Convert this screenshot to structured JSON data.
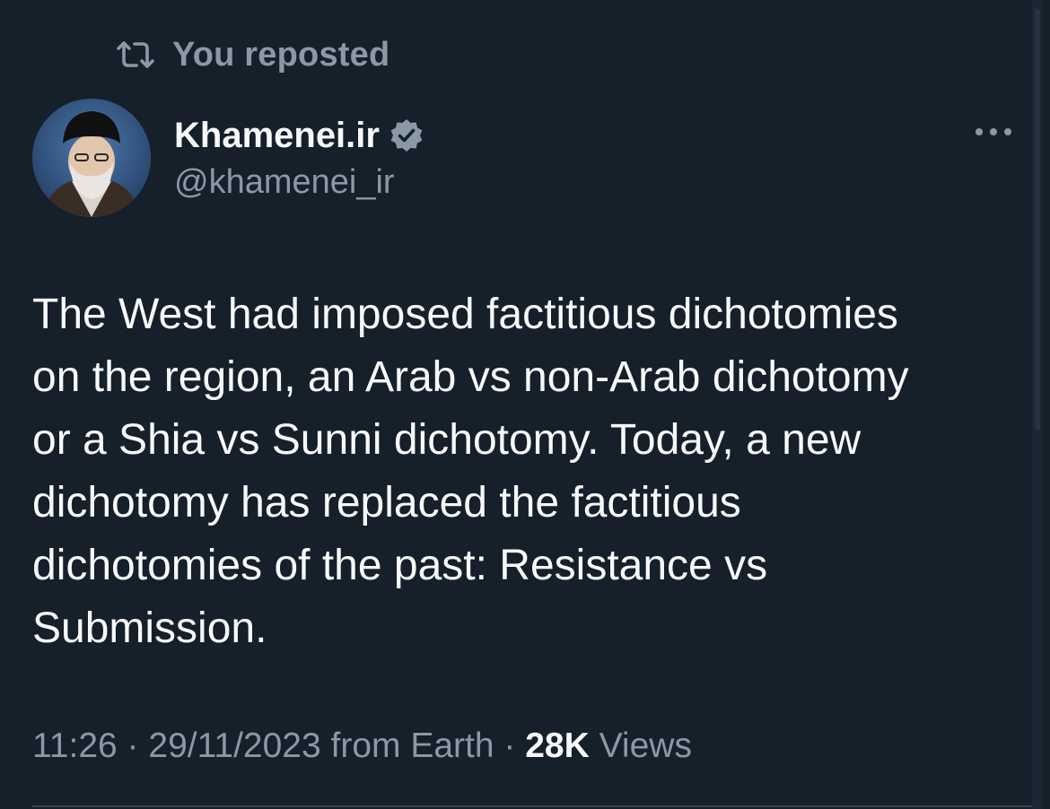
{
  "repost": {
    "label": "You reposted",
    "icon": "repost-icon"
  },
  "author": {
    "display_name": "Khamenei.ir",
    "handle": "@khamenei_ir",
    "verified": true,
    "badge_color": "#8b98a5",
    "avatar_icon": "avatar"
  },
  "tweet": {
    "text": "The West had imposed factitious dichotomies\non the region, an Arab vs non-Arab dichotomy\nor a Shia vs Sunni dichotomy. Today, a new\ndichotomy has replaced the factitious\ndichotomies of the past: Resistance vs\nSubmission."
  },
  "meta": {
    "time": "11:26",
    "separator1": " · ",
    "date": "29/11/2023",
    "source": " from Earth",
    "separator2": " · ",
    "views_count": "28K",
    "views_label": " Views"
  },
  "actions": {
    "more_icon": "more-icon"
  },
  "colors": {
    "background": "#15202b",
    "primary_text": "#f7f9f9",
    "secondary_text": "#8b98a5"
  }
}
